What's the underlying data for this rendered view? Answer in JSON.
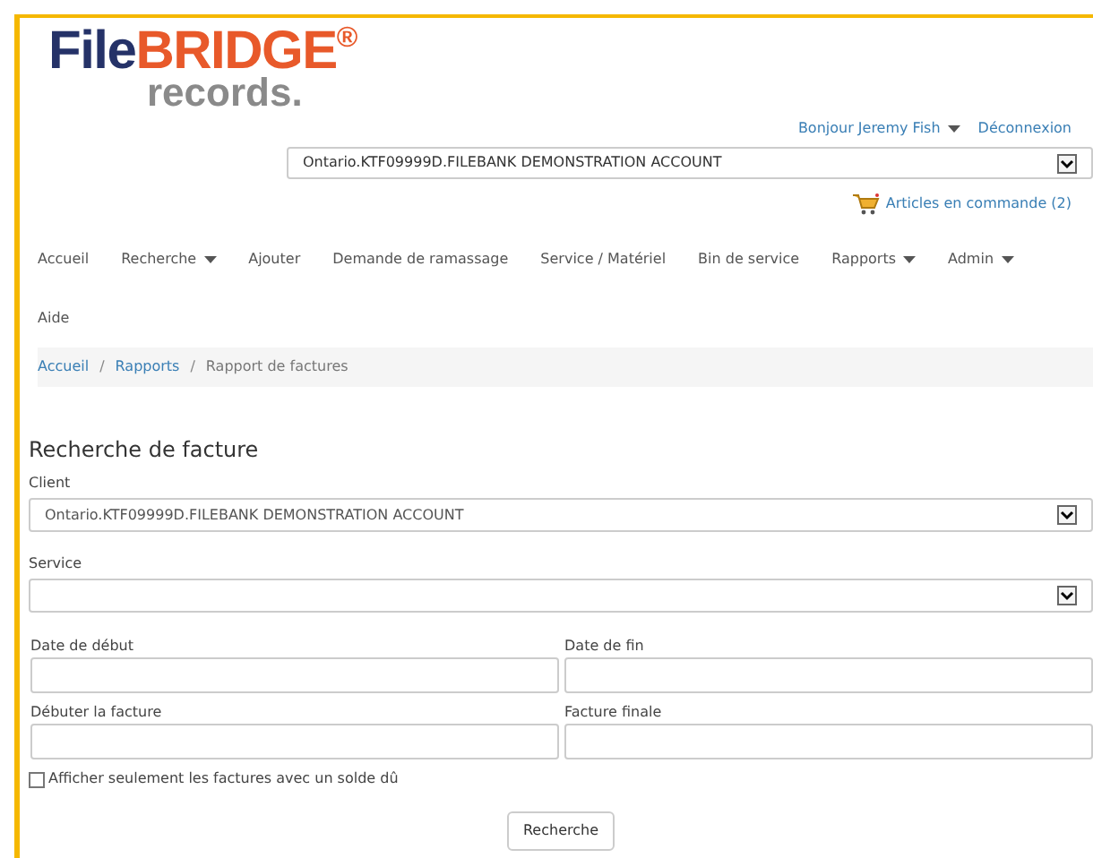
{
  "logo": {
    "part_1": "File",
    "part_2": "BRIDGE",
    "mark": "®",
    "tagline": "records."
  },
  "user_menu": {
    "greeting": "Bonjour Jeremy Fish",
    "logout": "Déconnexion"
  },
  "account_select": {
    "value": "Ontario.KTF09999D.FILEBANK DEMONSTRATION ACCOUNT"
  },
  "cart_link": "Articles en commande (2)",
  "nav": [
    {
      "label": "Accueil",
      "dropdown": false
    },
    {
      "label": "Recherche",
      "dropdown": true
    },
    {
      "label": "Ajouter",
      "dropdown": false
    },
    {
      "label": "Demande de ramassage",
      "dropdown": false
    },
    {
      "label": "Service / Matériel",
      "dropdown": false
    },
    {
      "label": "Bin de service",
      "dropdown": false
    },
    {
      "label": "Rapports",
      "dropdown": true
    },
    {
      "label": "Admin",
      "dropdown": true
    },
    {
      "label": "Aide",
      "dropdown": false
    }
  ],
  "breadcrumb_separator": "/",
  "breadcrumb": [
    {
      "label": "Accueil",
      "link": true
    },
    {
      "label": "Rapports",
      "link": true
    },
    {
      "label": "Rapport de factures",
      "link": false
    }
  ],
  "form": {
    "title": "Recherche de facture",
    "client": {
      "label": "Client",
      "value": "Ontario.KTF09999D.FILEBANK DEMONSTRATION ACCOUNT"
    },
    "service": {
      "label": "Service"
    },
    "fields": [
      {
        "label": "Date de début"
      },
      {
        "label": "Date de fin"
      },
      {
        "label": "Débuter la facture"
      },
      {
        "label": "Facture finale"
      }
    ],
    "balance_only": {
      "label": "Afficher seulement les factures avec un solde dû",
      "checked": false
    },
    "submit": "Recherche"
  }
}
